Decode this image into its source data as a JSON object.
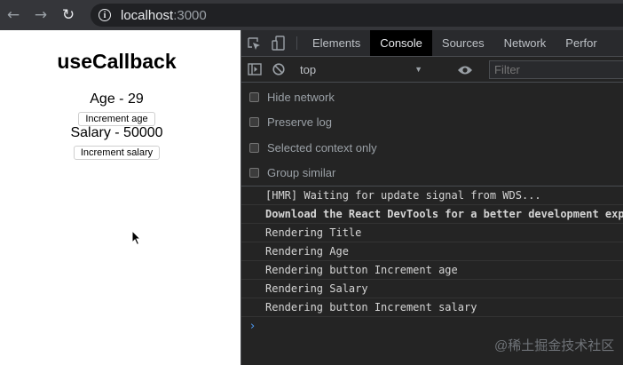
{
  "browser": {
    "url_host": "localhost",
    "url_port": ":3000"
  },
  "app": {
    "title": "useCallback",
    "age_text": "Age - 29",
    "increment_age_label": "Increment age",
    "salary_text": "Salary - 50000",
    "increment_salary_label": "Increment salary"
  },
  "devtools": {
    "tabs": [
      {
        "label": "Elements"
      },
      {
        "label": "Console",
        "active": true
      },
      {
        "label": "Sources"
      },
      {
        "label": "Network"
      },
      {
        "label": "Perfor"
      }
    ],
    "context": "top",
    "filter_placeholder": "Filter",
    "settings": [
      {
        "label": "Hide network"
      },
      {
        "label": "Preserve log"
      },
      {
        "label": "Selected context only"
      },
      {
        "label": "Group similar"
      }
    ],
    "log": [
      {
        "text": "[HMR] Waiting for update signal from WDS...",
        "bold": false
      },
      {
        "text": "Download the React DevTools for a better development exp",
        "bold": true
      },
      {
        "text": "Rendering Title",
        "bold": false
      },
      {
        "text": "Rendering Age",
        "bold": false
      },
      {
        "text": "Rendering button Increment age",
        "bold": false
      },
      {
        "text": "Rendering Salary",
        "bold": false
      },
      {
        "text": "Rendering button Increment salary",
        "bold": false
      }
    ],
    "prompt_symbol": "›"
  },
  "watermark": "@稀土掘金技术社区",
  "colors": {
    "accent_blue": "#4e9bf5",
    "chrome_bg": "#35363a",
    "devtools_bg": "#242424"
  }
}
